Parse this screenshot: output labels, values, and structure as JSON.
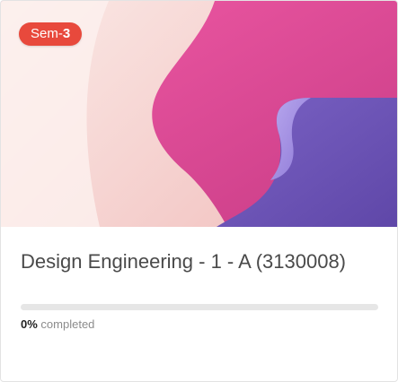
{
  "course": {
    "semester_prefix": "Sem-",
    "semester_number": "3",
    "title": "Design Engineering - 1 - A (3130008)",
    "progress_percent": 0,
    "progress_label": "0%",
    "progress_suffix": "completed"
  },
  "colors": {
    "badge": "#e8493c",
    "cover_pink": "#e24c9a",
    "cover_purple": "#6e55b6",
    "cover_light": "#f8dcd9"
  }
}
